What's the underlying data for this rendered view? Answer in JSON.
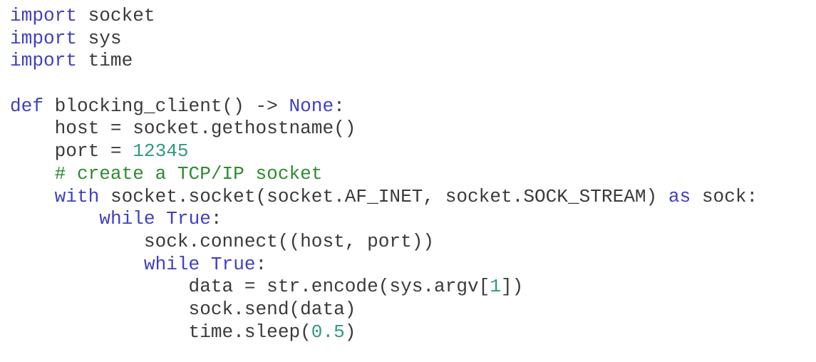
{
  "code": {
    "language": "python",
    "colors": {
      "keyword": "#3f3fc4",
      "number": "#2e9a7e",
      "comment": "#2e8b2e",
      "default": "#3a3a3a",
      "background": "#ffffff"
    },
    "lines": [
      {
        "indent": 0,
        "tokens": [
          {
            "t": "kw",
            "v": "import"
          },
          {
            "t": "tx",
            "v": " socket"
          }
        ]
      },
      {
        "indent": 0,
        "tokens": [
          {
            "t": "kw",
            "v": "import"
          },
          {
            "t": "tx",
            "v": " sys"
          }
        ]
      },
      {
        "indent": 0,
        "tokens": [
          {
            "t": "kw",
            "v": "import"
          },
          {
            "t": "tx",
            "v": " time"
          }
        ]
      },
      {
        "indent": 0,
        "tokens": []
      },
      {
        "indent": 0,
        "tokens": [
          {
            "t": "kw",
            "v": "def"
          },
          {
            "t": "tx",
            "v": " blocking_client() -> "
          },
          {
            "t": "kw",
            "v": "None"
          },
          {
            "t": "tx",
            "v": ":"
          }
        ]
      },
      {
        "indent": 4,
        "tokens": [
          {
            "t": "tx",
            "v": "host = socket.gethostname()"
          }
        ]
      },
      {
        "indent": 4,
        "tokens": [
          {
            "t": "tx",
            "v": "port = "
          },
          {
            "t": "num",
            "v": "12345"
          }
        ]
      },
      {
        "indent": 4,
        "tokens": [
          {
            "t": "cm",
            "v": "# create a TCP/IP socket"
          }
        ]
      },
      {
        "indent": 4,
        "tokens": [
          {
            "t": "kw",
            "v": "with"
          },
          {
            "t": "tx",
            "v": " socket.socket(socket.AF_INET, socket.SOCK_STREAM) "
          },
          {
            "t": "kw",
            "v": "as"
          },
          {
            "t": "tx",
            "v": " sock:"
          }
        ]
      },
      {
        "indent": 8,
        "tokens": [
          {
            "t": "kw",
            "v": "while"
          },
          {
            "t": "tx",
            "v": " "
          },
          {
            "t": "kw",
            "v": "True"
          },
          {
            "t": "tx",
            "v": ":"
          }
        ]
      },
      {
        "indent": 12,
        "tokens": [
          {
            "t": "tx",
            "v": "sock.connect((host, port))"
          }
        ]
      },
      {
        "indent": 12,
        "tokens": [
          {
            "t": "kw",
            "v": "while"
          },
          {
            "t": "tx",
            "v": " "
          },
          {
            "t": "kw",
            "v": "True"
          },
          {
            "t": "tx",
            "v": ":"
          }
        ]
      },
      {
        "indent": 16,
        "tokens": [
          {
            "t": "tx",
            "v": "data = str.encode(sys.argv["
          },
          {
            "t": "num",
            "v": "1"
          },
          {
            "t": "tx",
            "v": "])"
          }
        ]
      },
      {
        "indent": 16,
        "tokens": [
          {
            "t": "tx",
            "v": "sock.send(data)"
          }
        ]
      },
      {
        "indent": 16,
        "tokens": [
          {
            "t": "tx",
            "v": "time.sleep("
          },
          {
            "t": "num",
            "v": "0.5"
          },
          {
            "t": "tx",
            "v": ")"
          }
        ]
      }
    ]
  }
}
